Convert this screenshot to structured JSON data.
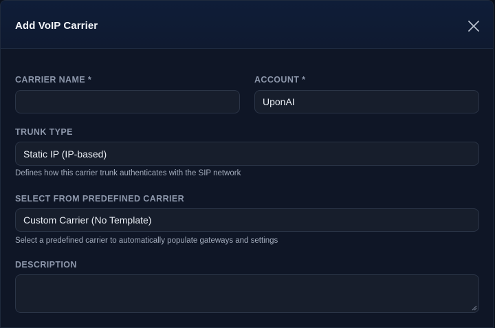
{
  "modal": {
    "title": "Add VoIP Carrier",
    "close_icon": "close-icon"
  },
  "form": {
    "carrier_name": {
      "label": "CARRIER NAME *",
      "value": "",
      "placeholder": ""
    },
    "account": {
      "label": "ACCOUNT *",
      "selected": "UponAI"
    },
    "trunk_type": {
      "label": "TRUNK TYPE",
      "selected": "Static IP (IP-based)",
      "help": "Defines how this carrier trunk authenticates with the SIP network"
    },
    "predefined_carrier": {
      "label": "SELECT FROM PREDEFINED CARRIER",
      "selected": "Custom Carrier (No Template)",
      "help": "Select a predefined carrier to automatically populate gateways and settings"
    },
    "description": {
      "label": "DESCRIPTION",
      "value": ""
    }
  },
  "colors": {
    "background": "#0f1626",
    "header": "#0f1d38",
    "field": "#171e2c",
    "field_border": "#2b3547",
    "label": "#8d97ab",
    "text": "#e9edf3"
  }
}
